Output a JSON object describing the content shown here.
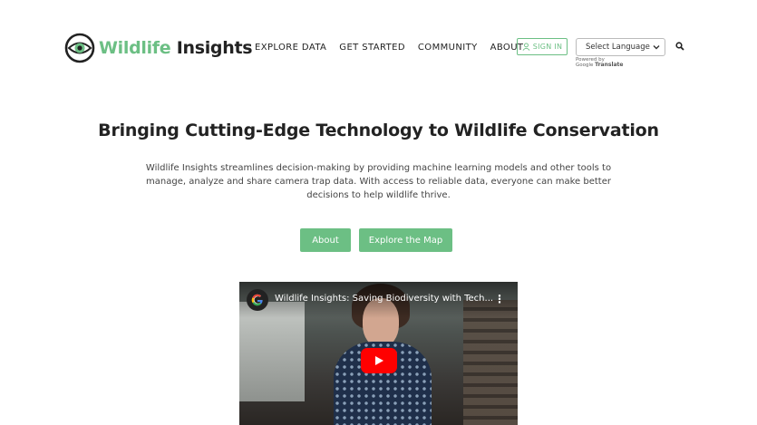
{
  "header": {
    "logo_word1": "Wildlife",
    "logo_word2": "Insights",
    "nav": [
      "EXPLORE DATA",
      "GET STARTED",
      "COMMUNITY",
      "ABOUT"
    ],
    "sign_in": "SIGN IN",
    "language_select": "Select Language",
    "powered_by": "Powered by",
    "google": "Google",
    "translate": "Translate"
  },
  "hero": {
    "title": "Bringing Cutting-Edge Technology to Wildlife Conservation",
    "description": "Wildlife Insights streamlines decision-making by providing machine learning models and other tools to manage, analyze and share camera trap data. With access to reliable data, everyone can make better decisions to help wildlife thrive.",
    "about_button": "About",
    "map_button": "Explore the Map"
  },
  "video": {
    "title": "Wildlife Insights: Saving Biodiversity with Tech...",
    "menu": "⋮"
  },
  "colors": {
    "accent": "#6cbf84",
    "youtube_red": "#ff0000"
  },
  "icons": [
    "logo-eye-icon",
    "user-icon",
    "chevron-down-icon",
    "search-icon",
    "google-g-icon",
    "play-icon",
    "kebab-menu-icon"
  ]
}
